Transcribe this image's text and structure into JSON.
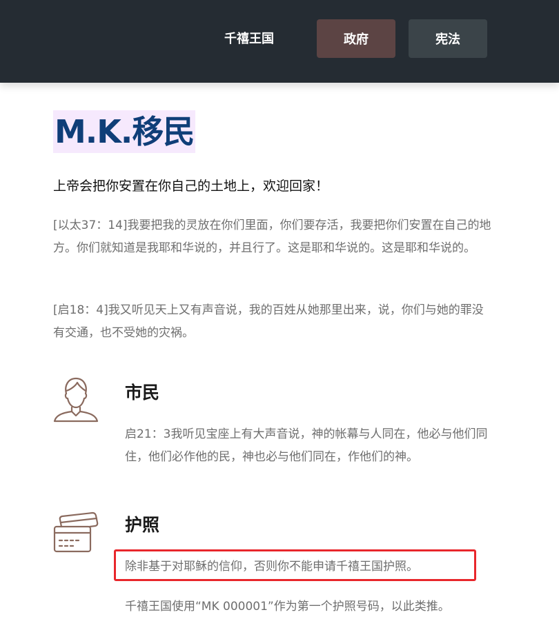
{
  "nav": {
    "brand_link": "千禧王国",
    "government_button": "政府",
    "constitution_button": "宪法"
  },
  "page": {
    "title": "M.K.移民",
    "tagline": "上帝会把你安置在你自己的土地上，欢迎回家！",
    "verse1": "[以太37：14]我要把我的灵放在你们里面，你们要存活，我要把你们安置在自己的地方。你们就知道是我耶和华说的，并且行了。这是耶和华说的。这是耶和华说的。",
    "verse2": "[启18：4]我又听见天上又有声音说，我的百姓从她那里出来，说，你们与她的罪没有交通，也不受她的灾祸。"
  },
  "features": {
    "citizen": {
      "icon": "person-icon",
      "title": "市民",
      "text": "启21：3我听见宝座上有大声音说，神的帐幕与人同在，他必与他们同住，他们必作他的民，神也必与他们同在，作他们的神。"
    },
    "passport": {
      "icon": "cards-icon",
      "title": "护照",
      "text1": "除非基于对耶稣的信仰，否则你不能申请千禧王国护照。",
      "text2": "千禧王国使用“MK 000001”作为第一个护照号码，以此类推。"
    }
  },
  "colors": {
    "header_bg": "#252c33",
    "gov_button_bg": "#5c4444",
    "con_button_bg": "#3b4449",
    "title_color": "#0f3e78",
    "title_highlight": "#f6e9fd",
    "icon_color": "#8a6a5e",
    "highlight_border": "#e8262b"
  }
}
